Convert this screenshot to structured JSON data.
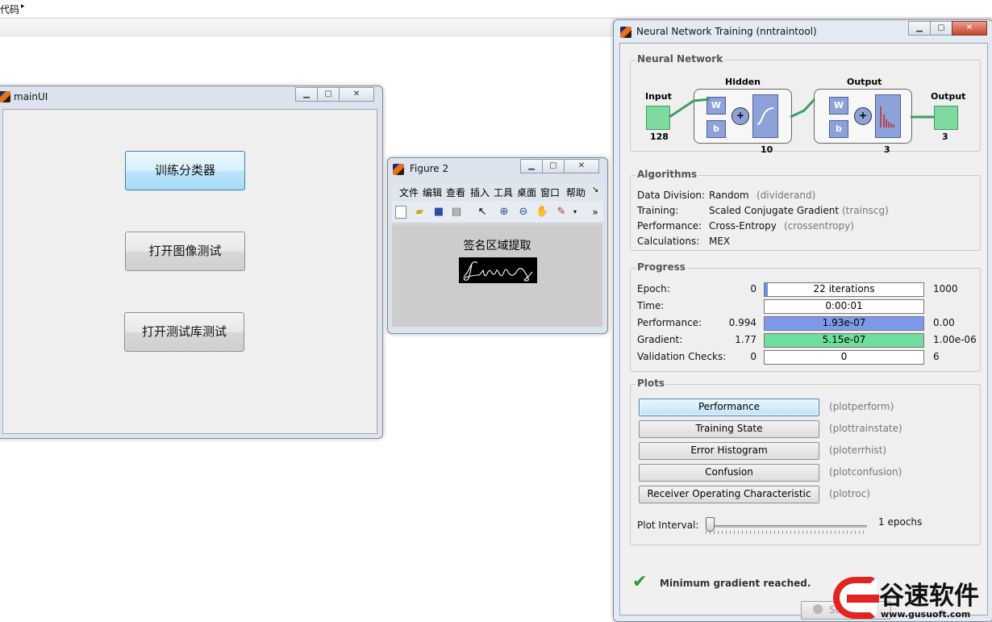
{
  "top": {
    "crumb": "代码",
    "crumb_arrow": "▸"
  },
  "mainui": {
    "title": "mainUI",
    "buttons": [
      "训练分类器",
      "打开图像测试",
      "打开测试库测试"
    ]
  },
  "figure2": {
    "title": "Figure 2",
    "menu": [
      "文件",
      "编辑",
      "查看",
      "插入",
      "工具",
      "桌面",
      "窗口",
      "帮助",
      "↘"
    ],
    "toolbar_icons": [
      "new-file-icon",
      "open-folder-icon",
      "save-icon",
      "print-icon",
      "pointer-icon",
      "zoom-in-icon",
      "zoom-out-icon",
      "pan-hand-icon",
      "data-cursor-icon"
    ],
    "overflow": "»",
    "plot_title": "签名区域提取"
  },
  "nn": {
    "title": "Neural Network Training (nntraintool)",
    "network": {
      "group_title": "Neural Network",
      "input_label": "Input",
      "input_size": "128",
      "hidden_label": "Hidden",
      "hidden_size": "10",
      "output_layer_label": "Output",
      "output_layer_size": "3",
      "output_label": "Output",
      "output_size": "3",
      "w": "W",
      "b": "b"
    },
    "algorithms": {
      "group_title": "Algorithms",
      "rows": [
        {
          "label": "Data Division:",
          "value": "Random",
          "fn": "(dividerand)"
        },
        {
          "label": "Training:",
          "value": "Scaled Conjugate Gradient",
          "fn": "(trainscg)"
        },
        {
          "label": "Performance:",
          "value": "Cross-Entropy",
          "fn": "(crossentropy)"
        },
        {
          "label": "Calculations:",
          "value": "MEX",
          "fn": ""
        }
      ]
    },
    "progress": {
      "group_title": "Progress",
      "rows": [
        {
          "label": "Epoch:",
          "start": "0",
          "bar": "22 iterations",
          "end": "1000",
          "fill": 0.022,
          "color": "#6f8fe0"
        },
        {
          "label": "Time:",
          "start": "",
          "bar": "0:00:01",
          "end": "",
          "fill": 0,
          "color": "#ffffff"
        },
        {
          "label": "Performance:",
          "start": "0.994",
          "bar": "1.93e-07",
          "end": "0.00",
          "fill": 1.0,
          "color": "#7c9ae8"
        },
        {
          "label": "Gradient:",
          "start": "1.77",
          "bar": "5.15e-07",
          "end": "1.00e-06",
          "fill": 1.0,
          "color": "#6fdca0"
        },
        {
          "label": "Validation Checks:",
          "start": "0",
          "bar": "0",
          "end": "6",
          "fill": 0,
          "color": "#ffffff"
        }
      ]
    },
    "plots": {
      "group_title": "Plots",
      "buttons": [
        {
          "label": "Performance",
          "fn": "(plotperform)"
        },
        {
          "label": "Training State",
          "fn": "(plottrainstate)"
        },
        {
          "label": "Error Histogram",
          "fn": "(ploterrhist)"
        },
        {
          "label": "Confusion",
          "fn": "(plotconfusion)"
        },
        {
          "label": "Receiver Operating Characteristic",
          "fn": "(plotroc)"
        }
      ],
      "interval_label": "Plot Interval:",
      "interval_value": "1 epochs",
      "interval_fraction": 0.0
    },
    "status": "Minimum gradient reached.",
    "stop_button": "St"
  },
  "watermark": {
    "brand": "谷速软件",
    "url": "www.gusuoft.com"
  }
}
